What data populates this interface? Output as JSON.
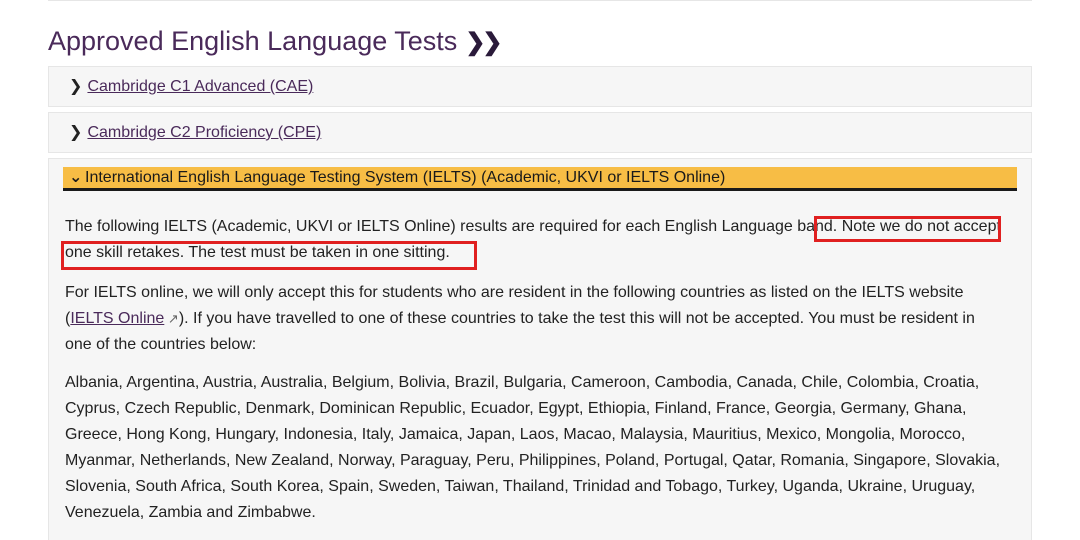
{
  "page": {
    "title": "Approved English Language Tests",
    "title_icon": "double-chevron-right-icon"
  },
  "accordion": {
    "items": [
      {
        "label": "Cambridge C1 Advanced (CAE)",
        "state": "collapsed",
        "icon": "chevron-right-icon"
      },
      {
        "label": "Cambridge C2 Proficiency (CPE)",
        "state": "collapsed",
        "icon": "chevron-right-icon"
      },
      {
        "label": "International English Language Testing System (IELTS) (Academic, UKVI or IELTS Online)",
        "state": "expanded",
        "icon": "chevron-down-icon"
      }
    ],
    "expanded_content": {
      "para1_plain": "The following IELTS (Academic, UKVI or IELTS Online) results are required for each English Language band.",
      "para1_highlight_a": "Note we do not accept",
      "para1_highlight_b": "one skill retakes. The test must be taken in one sitting.",
      "para2_before": "For IELTS online, we will only accept this for students who are resident in the following countries as listed on the IELTS website (",
      "para2_link": "IELTS Online",
      "para2_after": "). If you have travelled to one of these countries to take the test this will not be accepted. You must be resident in one of the countries below:",
      "para3": "Albania, Argentina, Austria, Australia, Belgium, Bolivia, Brazil, Bulgaria, Cameroon, Cambodia, Canada, Chile, Colombia, Croatia, Cyprus, Czech Republic, Denmark, Dominican Republic, Ecuador, Egypt, Ethiopia, Finland, France, Georgia, Germany, Ghana, Greece, Hong Kong, Hungary, Indonesia, Italy, Jamaica, Japan, Laos, Macao, Malaysia, Mauritius, Mexico, Mongolia, Morocco, Myanmar, Netherlands, New Zealand, Norway, Paraguay, Peru, Philippines, Poland, Portugal, Qatar, Romania, Singapore, Slovakia, Slovenia, South Africa, South Korea, Spain, Sweden, Taiwan, Thailand, Trinidad and Tobago, Turkey, Uganda, Ukraine, Uruguay, Venezuela, Zambia and Zimbabwe."
    }
  },
  "colors": {
    "title": "#4a2a5a",
    "accordion_active": "#f7bd45",
    "highlight_box": "#e02020"
  }
}
